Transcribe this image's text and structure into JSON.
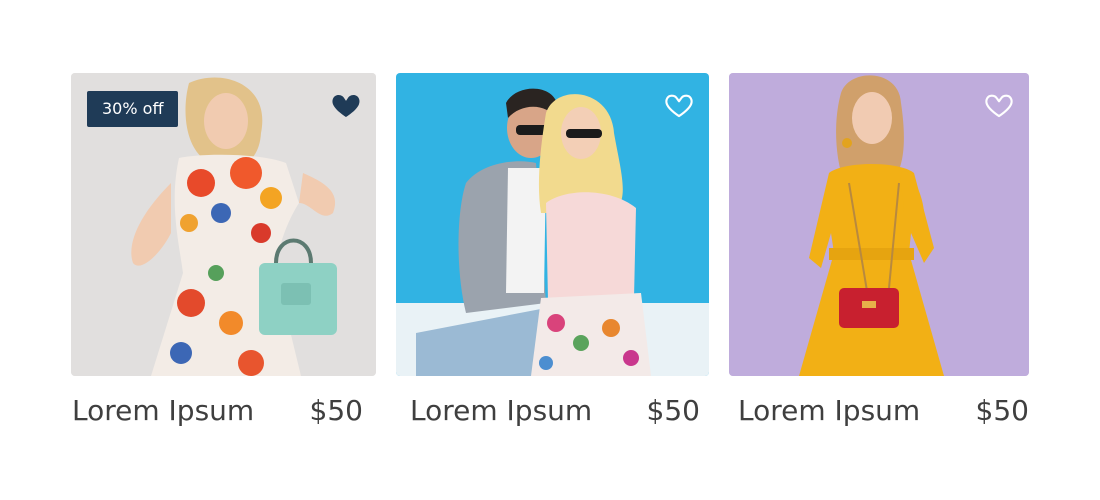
{
  "products": [
    {
      "name": "Lorem Ipsum",
      "price": "$50",
      "badge": "30% off",
      "favorited": true,
      "icon": "heart-filled-icon",
      "image": "woman-in-floral-dress-with-mint-handbag"
    },
    {
      "name": "Lorem Ipsum",
      "price": "$50",
      "favorited": false,
      "icon": "heart-outline-icon",
      "image": "couple-in-sunglasses-on-blue-background"
    },
    {
      "name": "Lorem Ipsum",
      "price": "$50",
      "favorited": false,
      "icon": "heart-outline-icon",
      "image": "woman-in-yellow-dress-with-red-bag"
    }
  ],
  "colors": {
    "badge_bg": "#1f3b57",
    "heart_filled": "#1f3b57",
    "heart_outline": "#ffffff",
    "text": "#3f3f3f"
  }
}
